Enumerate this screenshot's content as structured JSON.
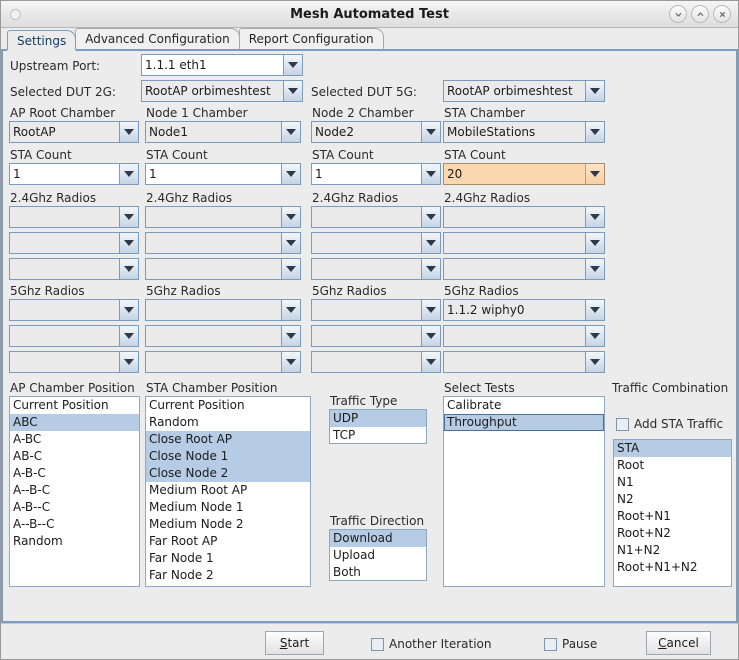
{
  "window": {
    "title": "Mesh Automated Test",
    "buttons": [
      {
        "name": "minimize-button",
        "glyph": "chevron-down-icon"
      },
      {
        "name": "maximize-button",
        "glyph": "chevron-up-icon"
      },
      {
        "name": "close-button",
        "glyph": "close-icon"
      }
    ]
  },
  "tabs": [
    {
      "label": "Settings",
      "active": true
    },
    {
      "label": "Advanced Configuration",
      "active": false
    },
    {
      "label": "Report Configuration",
      "active": false
    }
  ],
  "top_form": {
    "upstream_port_label": "Upstream Port:",
    "upstream_port_value": "1.1.1 eth1",
    "dut_2g_label": "Selected DUT 2G:",
    "dut_2g_value": "RootAP orbimeshtest",
    "dut_5g_label": "Selected DUT 5G:",
    "dut_5g_value": "RootAP orbimeshtest"
  },
  "columns": [
    {
      "chamber_label": "AP Root Chamber",
      "chamber_value": "RootAP",
      "sta_count_label": "STA Count",
      "sta_count_value": "1",
      "sta_count_highlight": false,
      "radios_24_label": "2.4Ghz Radios",
      "radios_24_values": [
        "",
        "",
        ""
      ],
      "radios_5_label": "5Ghz Radios",
      "radios_5_values": [
        "",
        "",
        ""
      ]
    },
    {
      "chamber_label": "Node 1 Chamber",
      "chamber_value": "Node1",
      "sta_count_label": "STA Count",
      "sta_count_value": "1",
      "sta_count_highlight": false,
      "radios_24_label": "2.4Ghz Radios",
      "radios_24_values": [
        "",
        "",
        ""
      ],
      "radios_5_label": "5Ghz Radios",
      "radios_5_values": [
        "",
        "",
        ""
      ]
    },
    {
      "chamber_label": "Node 2 Chamber",
      "chamber_value": "Node2",
      "sta_count_label": "STA Count",
      "sta_count_value": "1",
      "sta_count_highlight": false,
      "radios_24_label": "2.4Ghz Radios",
      "radios_24_values": [
        "",
        "",
        ""
      ],
      "radios_5_label": "5Ghz Radios",
      "radios_5_values": [
        "",
        "",
        ""
      ]
    },
    {
      "chamber_label": "STA Chamber",
      "chamber_value": "MobileStations",
      "sta_count_label": "STA Count",
      "sta_count_value": "20",
      "sta_count_highlight": true,
      "radios_24_label": "2.4Ghz Radios",
      "radios_24_values": [
        "",
        "",
        ""
      ],
      "radios_5_label": "5Ghz Radios",
      "radios_5_values": [
        "1.1.2 wiphy0",
        "",
        ""
      ]
    }
  ],
  "ap_chamber_position": {
    "label": "AP Chamber Position",
    "items": [
      {
        "label": "Current Position",
        "selected": false
      },
      {
        "label": "ABC",
        "selected": true
      },
      {
        "label": "A-BC",
        "selected": false
      },
      {
        "label": "AB-C",
        "selected": false
      },
      {
        "label": "A-B-C",
        "selected": false
      },
      {
        "label": "A--B-C",
        "selected": false
      },
      {
        "label": "A-B--C",
        "selected": false
      },
      {
        "label": "A--B--C",
        "selected": false
      },
      {
        "label": "Random",
        "selected": false
      }
    ]
  },
  "sta_chamber_position": {
    "label": "STA Chamber Position",
    "items": [
      {
        "label": "Current Position",
        "selected": false
      },
      {
        "label": "Random",
        "selected": false
      },
      {
        "label": "Close Root AP",
        "selected": true
      },
      {
        "label": "Close Node 1",
        "selected": true
      },
      {
        "label": "Close Node 2",
        "selected": true
      },
      {
        "label": "Medium Root AP",
        "selected": false
      },
      {
        "label": "Medium Node 1",
        "selected": false
      },
      {
        "label": "Medium Node 2",
        "selected": false
      },
      {
        "label": "Far Root AP",
        "selected": false
      },
      {
        "label": "Far Node 1",
        "selected": false
      },
      {
        "label": "Far Node 2",
        "selected": false
      }
    ]
  },
  "traffic_type": {
    "label": "Traffic Type",
    "items": [
      {
        "label": "UDP",
        "selected": true
      },
      {
        "label": "TCP",
        "selected": false
      }
    ]
  },
  "traffic_direction": {
    "label": "Traffic Direction",
    "items": [
      {
        "label": "Download",
        "selected": true
      },
      {
        "label": "Upload",
        "selected": false
      },
      {
        "label": "Both",
        "selected": false
      }
    ]
  },
  "select_tests": {
    "label": "Select Tests",
    "items": [
      {
        "label": "Calibrate",
        "selected": false,
        "focused": false
      },
      {
        "label": "Throughput",
        "selected": true,
        "focused": true
      }
    ]
  },
  "traffic_combination": {
    "label": "Traffic Combination",
    "add_sta_traffic_label": "Add STA Traffic",
    "add_sta_traffic_checked": false,
    "items": [
      {
        "label": "STA",
        "selected": true
      },
      {
        "label": "Root",
        "selected": false
      },
      {
        "label": "N1",
        "selected": false
      },
      {
        "label": "N2",
        "selected": false
      },
      {
        "label": "Root+N1",
        "selected": false
      },
      {
        "label": "Root+N2",
        "selected": false
      },
      {
        "label": "N1+N2",
        "selected": false
      },
      {
        "label": "Root+N1+N2",
        "selected": false
      }
    ]
  },
  "bottom_bar": {
    "start_label": "Start",
    "start_mnemonic": "S",
    "another_iteration_label": "Another Iteration",
    "another_iteration_checked": false,
    "pause_label": "Pause",
    "pause_checked": false,
    "cancel_label": "Cancel",
    "cancel_mnemonic": "C"
  },
  "colors": {
    "accent": "#7a9cc6",
    "selection": "#b6cbe4",
    "highlight_field": "#fbd7b0",
    "window_bg": "#ececec"
  }
}
